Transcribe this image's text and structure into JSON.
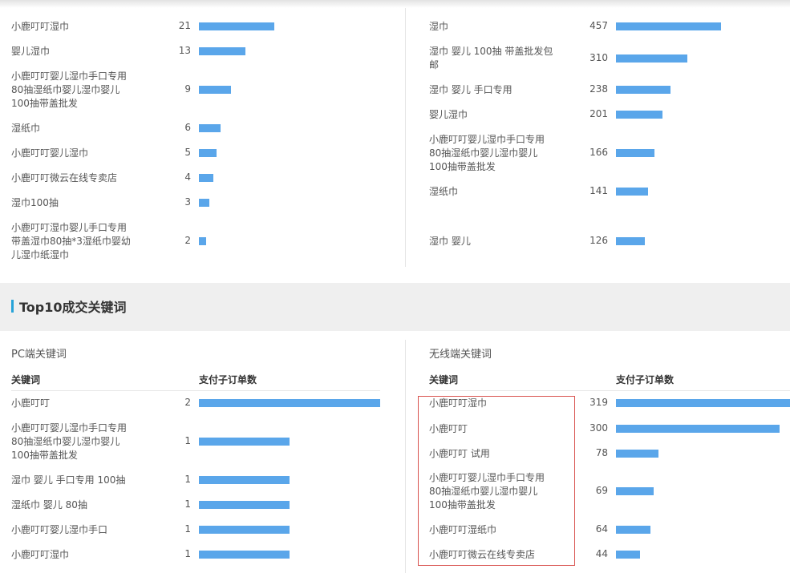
{
  "colors": {
    "bar": "#5aa6ea",
    "accent": "#27a3d8",
    "highlight_border": "#d9534f",
    "band": "#efefef"
  },
  "top_left": [
    {
      "keyword": "小鹿叮叮湿巾",
      "value": "21",
      "fraction": 0.415
    },
    {
      "keyword": "婴儿湿巾",
      "value": "13",
      "fraction": 0.257
    },
    {
      "keyword": "小鹿叮叮婴儿湿巾手口专用\n80抽湿纸巾婴儿湿巾婴儿\n100抽带盖批发",
      "value": "9",
      "fraction": 0.178
    },
    {
      "keyword": "湿纸巾",
      "value": "6",
      "fraction": 0.119
    },
    {
      "keyword": "小鹿叮叮婴儿湿巾",
      "value": "5",
      "fraction": 0.099
    },
    {
      "keyword": "小鹿叮叮微云在线专卖店",
      "value": "4",
      "fraction": 0.079
    },
    {
      "keyword": "湿巾100抽",
      "value": "3",
      "fraction": 0.059
    },
    {
      "keyword": "小鹿叮叮湿巾婴儿手口专用\n带盖湿巾80抽*3湿纸巾婴幼\n儿湿巾纸湿巾",
      "value": "2",
      "fraction": 0.04
    }
  ],
  "top_right": [
    {
      "keyword": "湿巾",
      "value": "457",
      "fraction": 0.603
    },
    {
      "keyword": "湿巾 婴儿 100抽 带盖批发包\n邮",
      "value": "310",
      "fraction": 0.409
    },
    {
      "keyword": "湿巾 婴儿 手口专用",
      "value": "238",
      "fraction": 0.314
    },
    {
      "keyword": "婴儿湿巾",
      "value": "201",
      "fraction": 0.265
    },
    {
      "keyword": "小鹿叮叮婴儿湿巾手口专用\n80抽湿纸巾婴儿湿巾婴儿\n100抽带盖批发",
      "value": "166",
      "fraction": 0.219
    },
    {
      "keyword": "湿纸巾",
      "value": "141",
      "fraction": 0.186
    },
    {
      "keyword": "湿巾 婴儿",
      "value": "126",
      "fraction": 0.166
    }
  ],
  "section": {
    "title": "Top10成交关键词"
  },
  "pc": {
    "title": "PC端关键词",
    "col_keyword": "关键词",
    "col_orders": "支付子订单数",
    "rows": [
      {
        "keyword": "小鹿叮叮",
        "value": "2",
        "fraction": 1.0
      },
      {
        "keyword": "小鹿叮叮婴儿湿巾手口专用\n80抽湿纸巾婴儿湿巾婴儿\n100抽带盖批发",
        "value": "1",
        "fraction": 0.5
      },
      {
        "keyword": "湿巾 婴儿 手口专用 100抽",
        "value": "1",
        "fraction": 0.5
      },
      {
        "keyword": "湿纸巾 婴儿 80抽",
        "value": "1",
        "fraction": 0.5
      },
      {
        "keyword": "小鹿叮叮婴儿湿巾手口",
        "value": "1",
        "fraction": 0.5
      },
      {
        "keyword": "小鹿叮叮湿巾",
        "value": "1",
        "fraction": 0.5
      }
    ]
  },
  "wireless": {
    "title": "无线端关键词",
    "col_keyword": "关键词",
    "col_orders": "支付子订单数",
    "rows": [
      {
        "keyword": "小鹿叮叮湿巾",
        "value": "319",
        "fraction": 1.0
      },
      {
        "keyword": "小鹿叮叮",
        "value": "300",
        "fraction": 0.94
      },
      {
        "keyword": "小鹿叮叮 试用",
        "value": "78",
        "fraction": 0.245
      },
      {
        "keyword": "小鹿叮叮婴儿湿巾手口专用\n80抽湿纸巾婴儿湿巾婴儿\n100抽带盖批发",
        "value": "69",
        "fraction": 0.216
      },
      {
        "keyword": "小鹿叮叮湿纸巾",
        "value": "64",
        "fraction": 0.2
      },
      {
        "keyword": "小鹿叮叮微云在线专卖店",
        "value": "44",
        "fraction": 0.138
      }
    ]
  }
}
